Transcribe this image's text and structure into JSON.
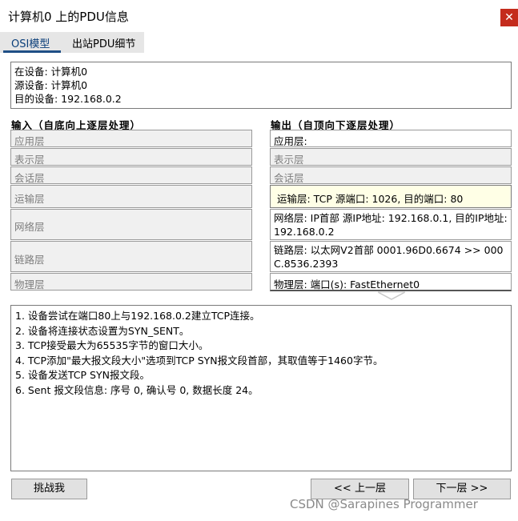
{
  "window": {
    "title": "计算机0 上的PDU信息",
    "close_glyph": "✕"
  },
  "tabs": [
    {
      "label": "OSI模型",
      "active": true
    },
    {
      "label": "出站PDU细节",
      "active": false
    }
  ],
  "device_info": [
    "在设备: 计算机0",
    "源设备: 计算机0",
    "目的设备: 192.168.0.2"
  ],
  "in_column": {
    "header": "输入（自底向上逐层处理）",
    "layers": [
      "应用层",
      "表示层",
      "会话层",
      "运输层",
      "网络层",
      "链路层",
      "物理层"
    ]
  },
  "out_column": {
    "header": "输出（自顶向下逐层处理）",
    "layers": [
      "应用层:",
      "表示层",
      "会话层",
      "运输层: TCP 源端口: 1026, 目的端口: 80",
      "网络层: IP首部 源IP地址: 192.168.0.1, 目的IP地址: 192.168.0.2",
      "链路层: 以太网V2首部 0001.96D0.6674 >> 000C.8536.2393",
      "物理层: 端口(s): FastEthernet0"
    ],
    "selected_index": 3
  },
  "log": [
    "1. 设备尝试在端口80上与192.168.0.2建立TCP连接。",
    "2. 设备将连接状态设置为SYN_SENT。",
    "3. TCP接受最大为65535字节的窗口大小。",
    "4. TCP添加\"最大报文段大小\"选项到TCP SYN报文段首部，其取值等于1460字节。",
    "5. 设备发送TCP SYN报文段。",
    "6. Sent 报文段信息: 序号 0, 确认号 0, 数据长度 24。"
  ],
  "buttons": {
    "challenge": "挑战我",
    "prev": "<< 上一层",
    "next": "下一层 >>"
  },
  "watermark": "CSDN @Sarapines Programmer",
  "colors": {
    "close_bg": "#c42b1c",
    "active_tab_underline": "#1f4f86",
    "selected_layer_bg": "#ffffe6"
  }
}
